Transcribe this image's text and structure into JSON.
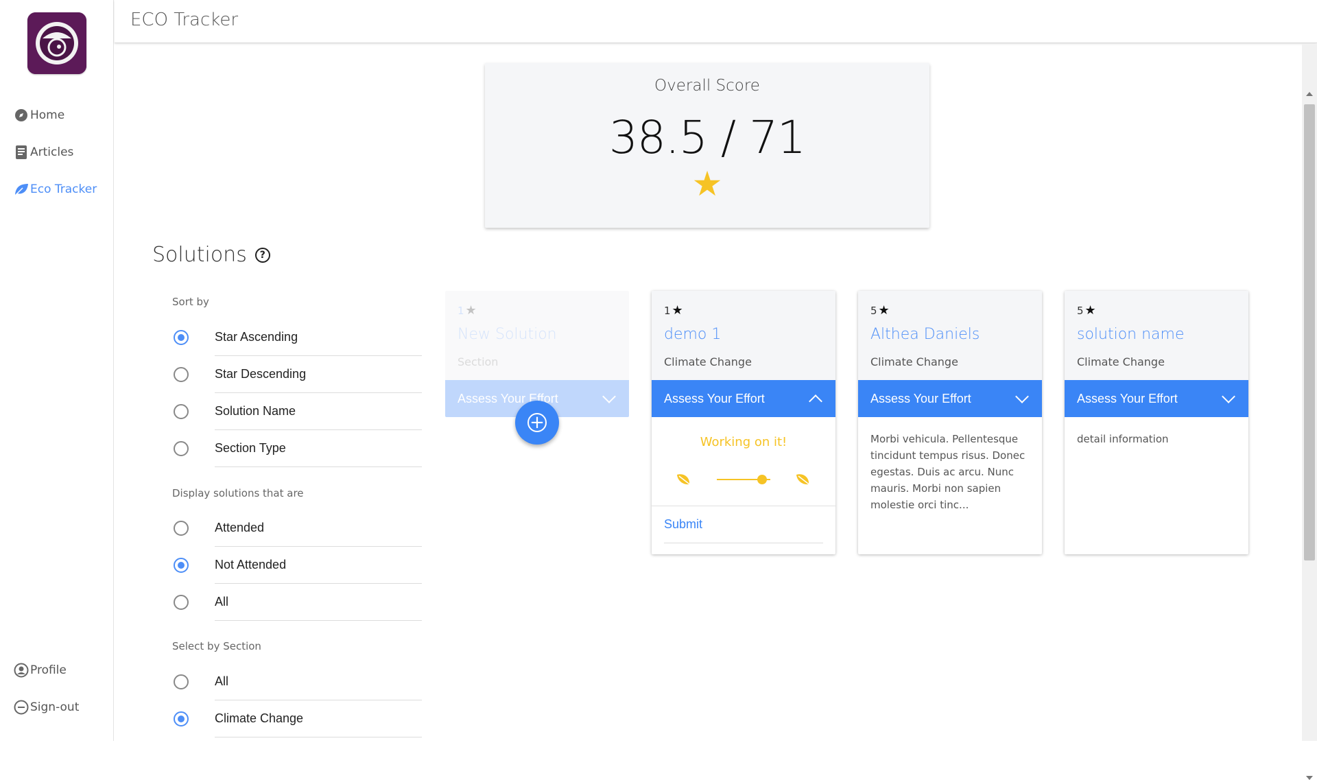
{
  "app": {
    "title": "ECO Tracker"
  },
  "sidebar": {
    "items": [
      {
        "label": "Home",
        "icon": "compass-icon"
      },
      {
        "label": "Articles",
        "icon": "document-icon"
      },
      {
        "label": "Eco Tracker",
        "icon": "leaf-icon",
        "active": true
      }
    ],
    "bottom_items": [
      {
        "label": "Profile",
        "icon": "user-circle-icon"
      },
      {
        "label": "Sign-out",
        "icon": "minus-circle-icon"
      }
    ]
  },
  "score": {
    "label": "Overall Score",
    "value": "38.5 / 71",
    "icon": "star-icon"
  },
  "solutions": {
    "title": "Solutions",
    "help_icon": "?"
  },
  "filters": {
    "sort_label": "Sort by",
    "sort_options": [
      {
        "label": "Star Ascending",
        "checked": true
      },
      {
        "label": "Star Descending",
        "checked": false
      },
      {
        "label": "Solution Name",
        "checked": false
      },
      {
        "label": "Section Type",
        "checked": false
      }
    ],
    "display_label": "Display solutions that are",
    "display_options": [
      {
        "label": "Attended",
        "checked": false
      },
      {
        "label": "Not Attended",
        "checked": true
      },
      {
        "label": "All",
        "checked": false
      }
    ],
    "section_label": "Select by Section",
    "section_options": [
      {
        "label": "All",
        "checked": false
      },
      {
        "label": "Climate Change",
        "checked": true
      }
    ]
  },
  "cards": [
    {
      "stars": "1",
      "name": "New Solution",
      "section": "Section",
      "assess_label": "Assess Your Effort"
    },
    {
      "stars": "1",
      "name": "demo 1",
      "section": "Climate Change",
      "assess_label": "Assess Your Effort",
      "status": "Working on it!",
      "effort_level": 0.6,
      "submit_label": "Submit"
    },
    {
      "stars": "5",
      "name": "Althea Daniels",
      "section": "Climate Change",
      "assess_label": "Assess Your Effort",
      "description": "Morbi vehicula. Pellentesque tincidunt tempus risus. Donec egestas. Duis ac arcu. Nunc mauris. Morbi non sapien molestie orci tinc..."
    },
    {
      "stars": "5",
      "name": "solution name",
      "section": "Climate Change",
      "assess_label": "Assess Your Effort",
      "description": "detail information"
    }
  ],
  "colors": {
    "accent": "#3a85f6",
    "star": "#f6c325",
    "logo": "#5c1a58"
  }
}
